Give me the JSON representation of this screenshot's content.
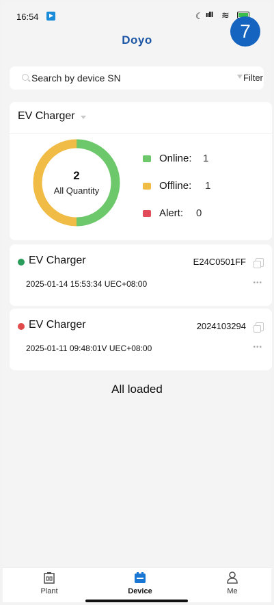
{
  "status_bar": {
    "time": "16:54",
    "moon": "☾",
    "signal": "ıılll",
    "wifi": "≋"
  },
  "badge": "7",
  "app_logo": "Doyo",
  "search": {
    "placeholder": "Search by device SN",
    "filter_label": "Filter"
  },
  "summary": {
    "selector_label": "EV Charger",
    "total": "2",
    "total_label": "All Quantity",
    "online": {
      "label": "Online:",
      "value": "1",
      "color": "#6cc86a"
    },
    "offline": {
      "label": "Offline:",
      "value": "1",
      "color": "#f0bc45"
    },
    "alert": {
      "label": "Alert:",
      "value": "0",
      "color": "#e24b57"
    }
  },
  "devices": [
    {
      "name": "EV Charger",
      "sn": "E24C0501FF",
      "datetime": "2025-01-14 15:53:34 UEC+08:00",
      "status_color": "#2a9d5a"
    },
    {
      "name": "EV Charger",
      "sn": "2024103294",
      "datetime": "2025-01-11 09:48:01V UEC+08:00",
      "status_color": "#e04a4a"
    }
  ],
  "more_glyph": "•••",
  "list_footer": "All loaded",
  "tabs": [
    {
      "label": "Plant",
      "icon": "plant-icon"
    },
    {
      "label": "Device",
      "icon": "device-icon"
    },
    {
      "label": "Me",
      "icon": "me-icon"
    }
  ]
}
